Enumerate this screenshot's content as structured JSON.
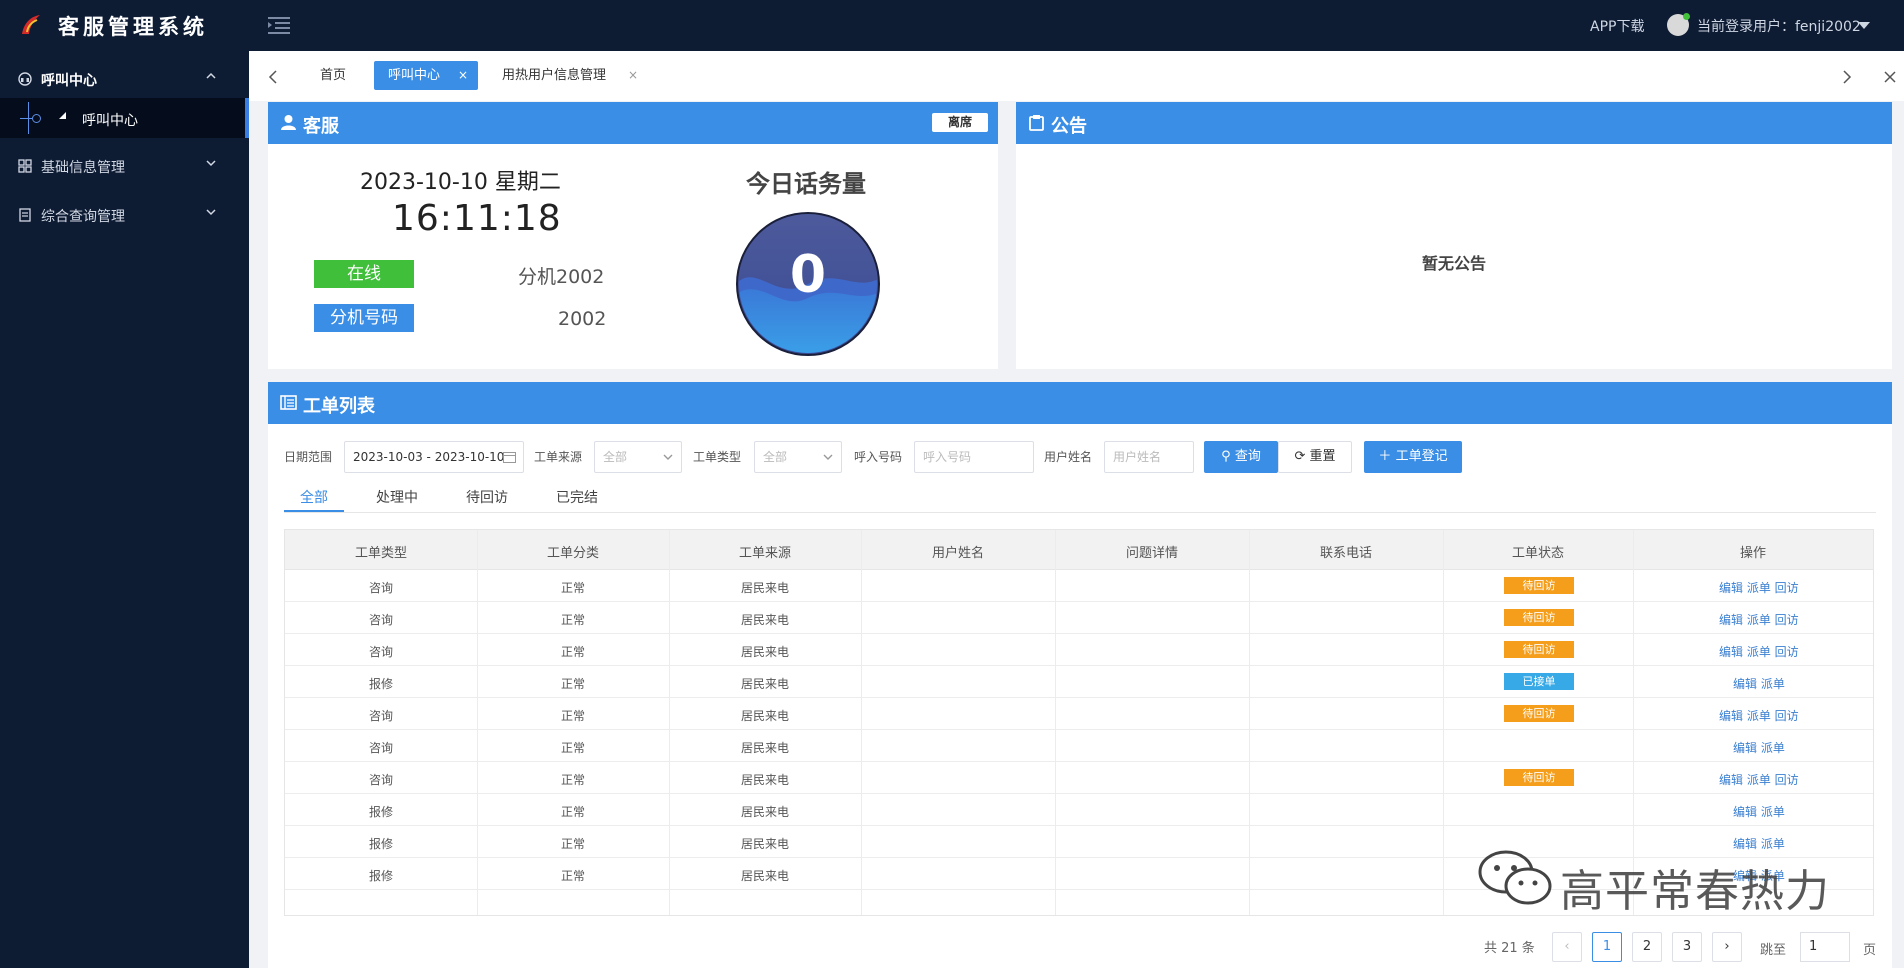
{
  "app": {
    "title": "客服管理系统"
  },
  "topbar": {
    "app_download": "APP下载",
    "current_user": "当前登录用户：fenji2002"
  },
  "sidebar": {
    "items": [
      {
        "label": "呼叫中心",
        "icon": "headset-icon"
      },
      {
        "label": "基础信息管理",
        "icon": "grid-icon"
      },
      {
        "label": "综合查询管理",
        "icon": "document-icon"
      }
    ],
    "sub_active": "呼叫中心"
  },
  "tabs": [
    {
      "label": "首页"
    },
    {
      "label": "呼叫中心",
      "close": "×"
    },
    {
      "label": "用热用户信息管理",
      "close": "×"
    }
  ],
  "cs_panel": {
    "title": "客服",
    "away_button": "离席",
    "date": "2023-10-10 星期二",
    "time": "16:11:18",
    "status": "在线",
    "extension_name": "分机2002",
    "extension_label": "分机号码",
    "extension_number": "2002",
    "today_title": "今日话务量",
    "today_count": "0"
  },
  "notice_panel": {
    "title": "公告",
    "empty_text": "暂无公告"
  },
  "orders_panel": {
    "title": "工单列表",
    "filters": {
      "date_label": "日期范围",
      "date_value": "2023-10-03 - 2023-10-10",
      "source_label": "工单来源",
      "source_value": "全部",
      "type_label": "工单类型",
      "type_value": "全部",
      "caller_label": "呼入号码",
      "caller_placeholder": "呼入号码",
      "username_label": "用户姓名",
      "username_placeholder": "用户姓名",
      "search_button": "查询",
      "reset_button": "重置",
      "register_button": "工单登记"
    },
    "subtabs": [
      "全部",
      "处理中",
      "待回访",
      "已完结"
    ],
    "columns": [
      "工单类型",
      "工单分类",
      "工单来源",
      "用户姓名",
      "问题详情",
      "联系电话",
      "工单状态",
      "操作"
    ],
    "rows": [
      {
        "type": "咨询",
        "category": "正常",
        "source": "居民来电",
        "status": "待回访",
        "status_kind": "warn",
        "ops": "编辑 派单 回访"
      },
      {
        "type": "咨询",
        "category": "正常",
        "source": "居民来电",
        "status": "待回访",
        "status_kind": "warn",
        "ops": "编辑 派单 回访"
      },
      {
        "type": "咨询",
        "category": "正常",
        "source": "居民来电",
        "status": "待回访",
        "status_kind": "warn",
        "ops": "编辑 派单 回访"
      },
      {
        "type": "报修",
        "category": "正常",
        "source": "居民来电",
        "status": "已接单",
        "status_kind": "info",
        "ops": "编辑 派单"
      },
      {
        "type": "咨询",
        "category": "正常",
        "source": "居民来电",
        "status": "待回访",
        "status_kind": "warn",
        "ops": "编辑 派单 回访"
      },
      {
        "type": "咨询",
        "category": "正常",
        "source": "居民来电",
        "status": "",
        "status_kind": "",
        "ops": "编辑 派单"
      },
      {
        "type": "咨询",
        "category": "正常",
        "source": "居民来电",
        "status": "待回访",
        "status_kind": "warn",
        "ops": "编辑 派单 回访"
      },
      {
        "type": "报修",
        "category": "正常",
        "source": "居民来电",
        "status": "",
        "status_kind": "",
        "ops": "编辑 派单"
      },
      {
        "type": "报修",
        "category": "正常",
        "source": "居民来电",
        "status": "",
        "status_kind": "",
        "ops": "编辑 派单"
      },
      {
        "type": "报修",
        "category": "正常",
        "source": "居民来电",
        "status": "",
        "status_kind": "",
        "ops": "编辑 派单"
      }
    ],
    "pagination": {
      "total": "共 21 条",
      "pages": [
        "1",
        "2",
        "3"
      ],
      "current": "1",
      "jump_label": "跳至",
      "jump_value": "1",
      "suffix": "页"
    }
  },
  "watermark": {
    "text": "高平常春热力",
    "icon": "wechat-icon"
  },
  "colors": {
    "primary": "#3a8ee6",
    "sidebar": "#0d1b33",
    "online": "#3fbf3a",
    "warn": "#f59e1b",
    "info": "#36a9e6"
  }
}
